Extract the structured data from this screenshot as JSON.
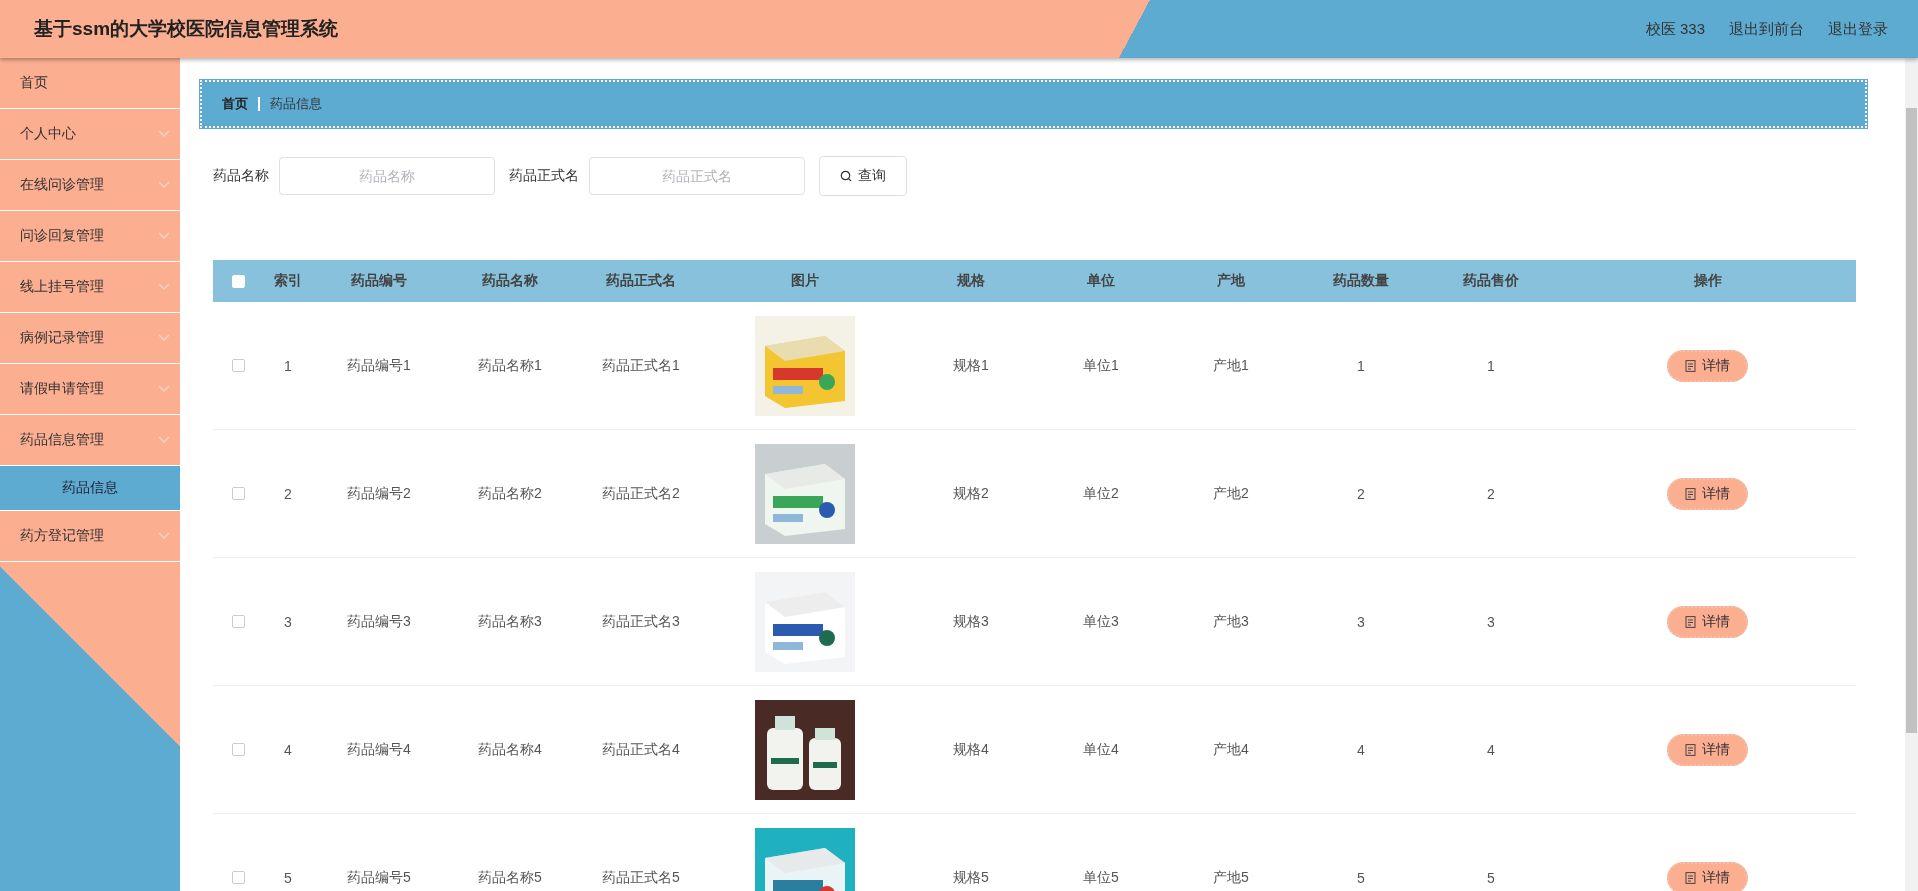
{
  "header": {
    "title": "基于ssm的大学校医院信息管理系统",
    "links": [
      "校医 333",
      "退出到前台",
      "退出登录"
    ]
  },
  "sidebar": {
    "items": [
      {
        "label": "首页",
        "kind": "link"
      },
      {
        "label": "个人中心",
        "kind": "menu"
      },
      {
        "label": "在线问诊管理",
        "kind": "menu"
      },
      {
        "label": "问诊回复管理",
        "kind": "menu"
      },
      {
        "label": "线上挂号管理",
        "kind": "menu"
      },
      {
        "label": "病例记录管理",
        "kind": "menu"
      },
      {
        "label": "请假申请管理",
        "kind": "menu"
      },
      {
        "label": "药品信息管理",
        "kind": "menu",
        "children": [
          {
            "label": "药品信息",
            "selected": true
          }
        ]
      },
      {
        "label": "药方登记管理",
        "kind": "menu"
      }
    ]
  },
  "breadcrumb": [
    "首页",
    "药品信息"
  ],
  "search": {
    "fields": [
      {
        "label": "药品名称",
        "placeholder": "药品名称"
      },
      {
        "label": "药品正式名",
        "placeholder": "药品正式名"
      }
    ],
    "button": "查询"
  },
  "table": {
    "select_all_checked": false,
    "columns": [
      "索引",
      "药品编号",
      "药品名称",
      "药品正式名",
      "图片",
      "规格",
      "单位",
      "产地",
      "药品数量",
      "药品售价",
      "操作"
    ],
    "rows": [
      {
        "checked": false,
        "cells": [
          "1",
          "药品编号1",
          "药品名称1",
          "药品正式名1",
          {
            "kind": "picture"
          },
          "规格1",
          "单位1",
          "产地1",
          "1",
          "1",
          {
            "kind": "button",
            "label": "详情"
          }
        ]
      },
      {
        "checked": false,
        "cells": [
          "2",
          "药品编号2",
          "药品名称2",
          "药品正式名2",
          {
            "kind": "picture"
          },
          "规格2",
          "单位2",
          "产地2",
          "2",
          "2",
          {
            "kind": "button",
            "label": "详情"
          }
        ]
      },
      {
        "checked": false,
        "cells": [
          "3",
          "药品编号3",
          "药品名称3",
          "药品正式名3",
          {
            "kind": "picture"
          },
          "规格3",
          "单位3",
          "产地3",
          "3",
          "3",
          {
            "kind": "button",
            "label": "详情"
          }
        ]
      },
      {
        "checked": false,
        "cells": [
          "4",
          "药品编号4",
          "药品名称4",
          "药品正式名4",
          {
            "kind": "picture"
          },
          "规格4",
          "单位4",
          "产地4",
          "4",
          "4",
          {
            "kind": "button",
            "label": "详情"
          }
        ]
      },
      {
        "checked": false,
        "cells": [
          "5",
          "药品编号5",
          "药品名称5",
          "药品正式名5",
          {
            "kind": "picture"
          },
          "规格5",
          "单位5",
          "产地5",
          "5",
          "5",
          {
            "kind": "button",
            "label": "详情"
          }
        ]
      }
    ]
  }
}
